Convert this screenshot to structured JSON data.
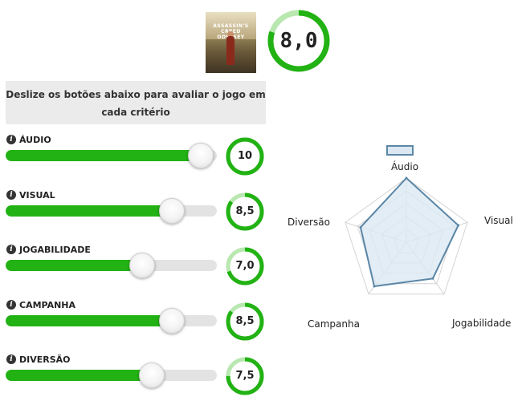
{
  "game": {
    "cover_title": "ASSASSIN'S CREED ODYSSEY"
  },
  "overall": {
    "score": "8,0",
    "value": 8.0,
    "max": 10
  },
  "instructions": "Deslize os botões abaixo para avaliar o jogo em cada critério",
  "colors": {
    "accent": "#22b214",
    "ring_light": "#b8e8b0",
    "track": "#e3e3e3",
    "radar_fill": "#dbe8f2",
    "radar_stroke": "#5b86a6"
  },
  "criteria": [
    {
      "label": "ÁUDIO",
      "score": "10",
      "value": 10
    },
    {
      "label": "VISUAL",
      "score": "8,5",
      "value": 8.5
    },
    {
      "label": "JOGABILIDADE",
      "score": "7,0",
      "value": 7.0
    },
    {
      "label": "CAMPANHA",
      "score": "8,5",
      "value": 8.5
    },
    {
      "label": "DIVERSÃO",
      "score": "7,5",
      "value": 7.5
    }
  ],
  "chart_data": {
    "type": "radar",
    "categories": [
      "Áudio",
      "Visual",
      "Jogabilidade",
      "Campanha",
      "Diversão"
    ],
    "series": [
      {
        "values": [
          10,
          8.5,
          7.0,
          8.5,
          7.5
        ]
      }
    ],
    "rlim": [
      0,
      10
    ],
    "grid": true,
    "legend": "top"
  }
}
